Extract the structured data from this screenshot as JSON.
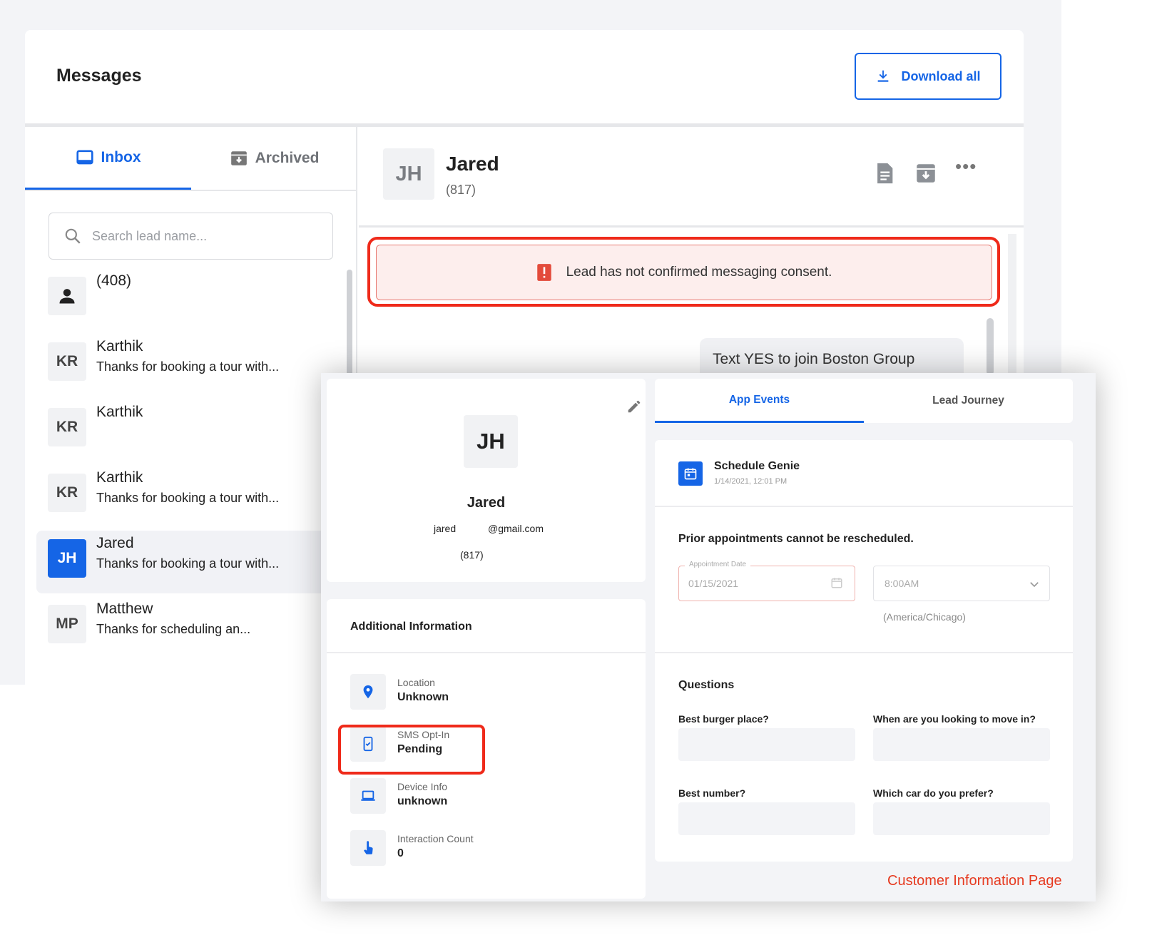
{
  "messages": {
    "title": "Messages",
    "download_label": "Download all",
    "tabs": {
      "inbox": "Inbox",
      "archived": "Archived"
    },
    "search_placeholder": "Search lead name...",
    "conversations": [
      {
        "avatar": "",
        "name": "(408)",
        "preview": ""
      },
      {
        "avatar": "KR",
        "name": "Karthik",
        "preview": "Thanks for booking a tour with..."
      },
      {
        "avatar": "KR",
        "name": "Karthik",
        "preview": ""
      },
      {
        "avatar": "KR",
        "name": "Karthik",
        "preview": "Thanks for booking a tour with..."
      },
      {
        "avatar": "JH",
        "name": "Jared",
        "preview": "Thanks for booking a tour with..."
      },
      {
        "avatar": "MP",
        "name": "Matthew",
        "preview": "Thanks for scheduling an..."
      }
    ]
  },
  "chat": {
    "avatar": "JH",
    "name": "Jared",
    "phone": "(817)",
    "more": "•••",
    "alert": "Lead has not confirmed messaging consent.",
    "bubble": "Text YES to join Boston Group"
  },
  "customer": {
    "avatar": "JH",
    "name": "Jared",
    "email_user": "jared",
    "email_domain": "@gmail.com",
    "phone": "(817)",
    "additional_title": "Additional Information",
    "info": {
      "location": {
        "label": "Location",
        "value": "Unknown"
      },
      "sms": {
        "label": "SMS Opt-In",
        "value": "Pending"
      },
      "device": {
        "label": "Device Info",
        "value": "unknown"
      },
      "interaction": {
        "label": "Interaction Count",
        "value": "0"
      }
    },
    "tabs": {
      "app_events": "App Events",
      "lead_journey": "Lead Journey"
    },
    "event": {
      "title": "Schedule Genie",
      "date": "1/14/2021, 12:01 PM",
      "prior_msg": "Prior appointments cannot be rescheduled.",
      "date_label": "Appointment Date",
      "date_value": "01/15/2021",
      "time_value": "8:00AM",
      "timezone": "(America/Chicago)"
    },
    "questions_title": "Questions",
    "questions": [
      "Best burger place?",
      "When are you looking to move in?",
      "Best number?",
      "Which car do you prefer?"
    ]
  },
  "caption": "Customer Information Page",
  "colors": {
    "accent": "#1565e6",
    "alert_red": "#ef2a1a",
    "caption": "#e63a20"
  }
}
